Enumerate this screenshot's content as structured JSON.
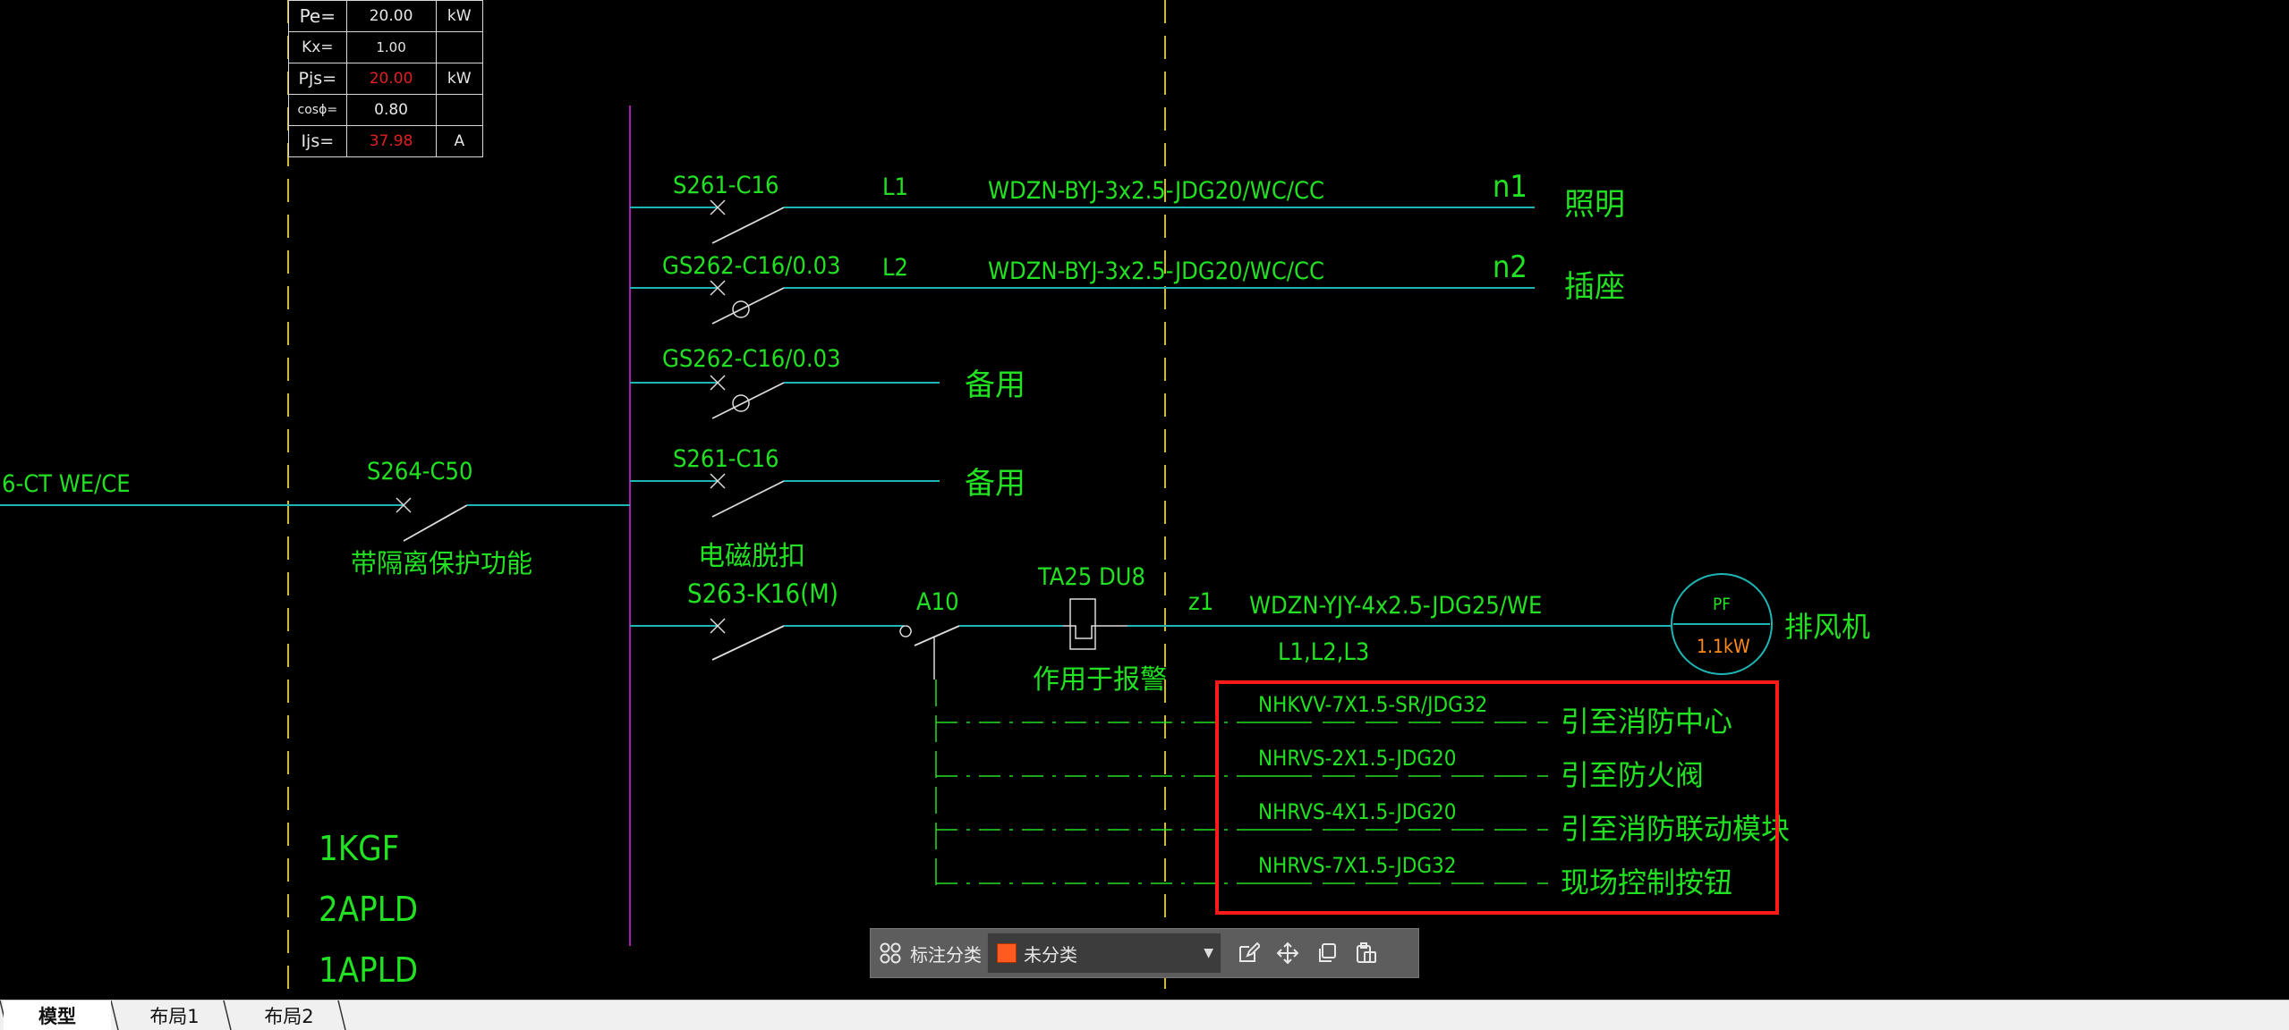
{
  "load_table": {
    "rows": [
      {
        "label": "Pe=",
        "value": "20.00",
        "unit": "kW"
      },
      {
        "label": "Kx=",
        "value": "1.00",
        "unit": ""
      },
      {
        "label": "Pjs=",
        "value": "20.00",
        "unit": "kW"
      },
      {
        "label": "cosϕ=",
        "value": "0.80",
        "unit": ""
      },
      {
        "label": "Ijs=",
        "value": "37.98",
        "unit": "A"
      }
    ]
  },
  "incoming": {
    "cable": "6-CT  WE/CE",
    "breaker": "S264-C50",
    "note": "带隔离保护功能"
  },
  "circuits": {
    "c1": {
      "breaker": "S261-C16",
      "phase": "L1",
      "cable": "WDZN-BYJ-3x2.5-JDG20/WC/CC",
      "id": "n1",
      "load": "照明"
    },
    "c2": {
      "breaker": "GS262-C16/0.03",
      "phase": "L2",
      "cable": "WDZN-BYJ-3x2.5-JDG20/WC/CC",
      "id": "n2",
      "load": "插座"
    },
    "c3": {
      "breaker": "GS262-C16/0.03",
      "load": "备用"
    },
    "c4": {
      "breaker": "S261-C16",
      "load": "备用"
    },
    "c5": {
      "trip_note": "电磁脱扣",
      "breaker": "S263-K16(M)",
      "contactor": "A10",
      "relay": "TA25 DU8",
      "relay_note": "作用于报警",
      "id": "z1",
      "cable": "WDZN-YJY-4x2.5-JDG25/WE",
      "phases": "L1,L2,L3",
      "motor_code": "PF",
      "motor_power": "1.1kW",
      "load": "排风机"
    }
  },
  "control_lines": [
    {
      "cable": "NHKVV-7X1.5-SR/JDG32",
      "dest": "引至消防中心"
    },
    {
      "cable": "NHRVS-2X1.5-JDG20",
      "dest": "引至防火阀"
    },
    {
      "cable": "NHRVS-4X1.5-JDG20",
      "dest": "引至消防联动模块"
    },
    {
      "cable": "NHRVS-7X1.5-JDG32",
      "dest": "现场控制按钮"
    }
  ],
  "panel_labels": [
    "1KGF",
    "2APLD",
    "1APLD"
  ],
  "toolbar": {
    "label": "标注分类",
    "select_value": "未分类",
    "icons": [
      "grid-icon",
      "edit-icon",
      "move-icon",
      "copy-icon",
      "paste-icon"
    ]
  },
  "tabs": [
    "模型",
    "布局1",
    "布局2"
  ],
  "colors": {
    "text_green": "#22e022",
    "wire_cyan": "#1fb5b5",
    "bus_magenta": "#b01ab0",
    "centerline_yellow": "#d8c000",
    "table_red": "#e02020",
    "motor_orange": "#ff8a1a",
    "highlight_red": "#ff1a1a"
  }
}
